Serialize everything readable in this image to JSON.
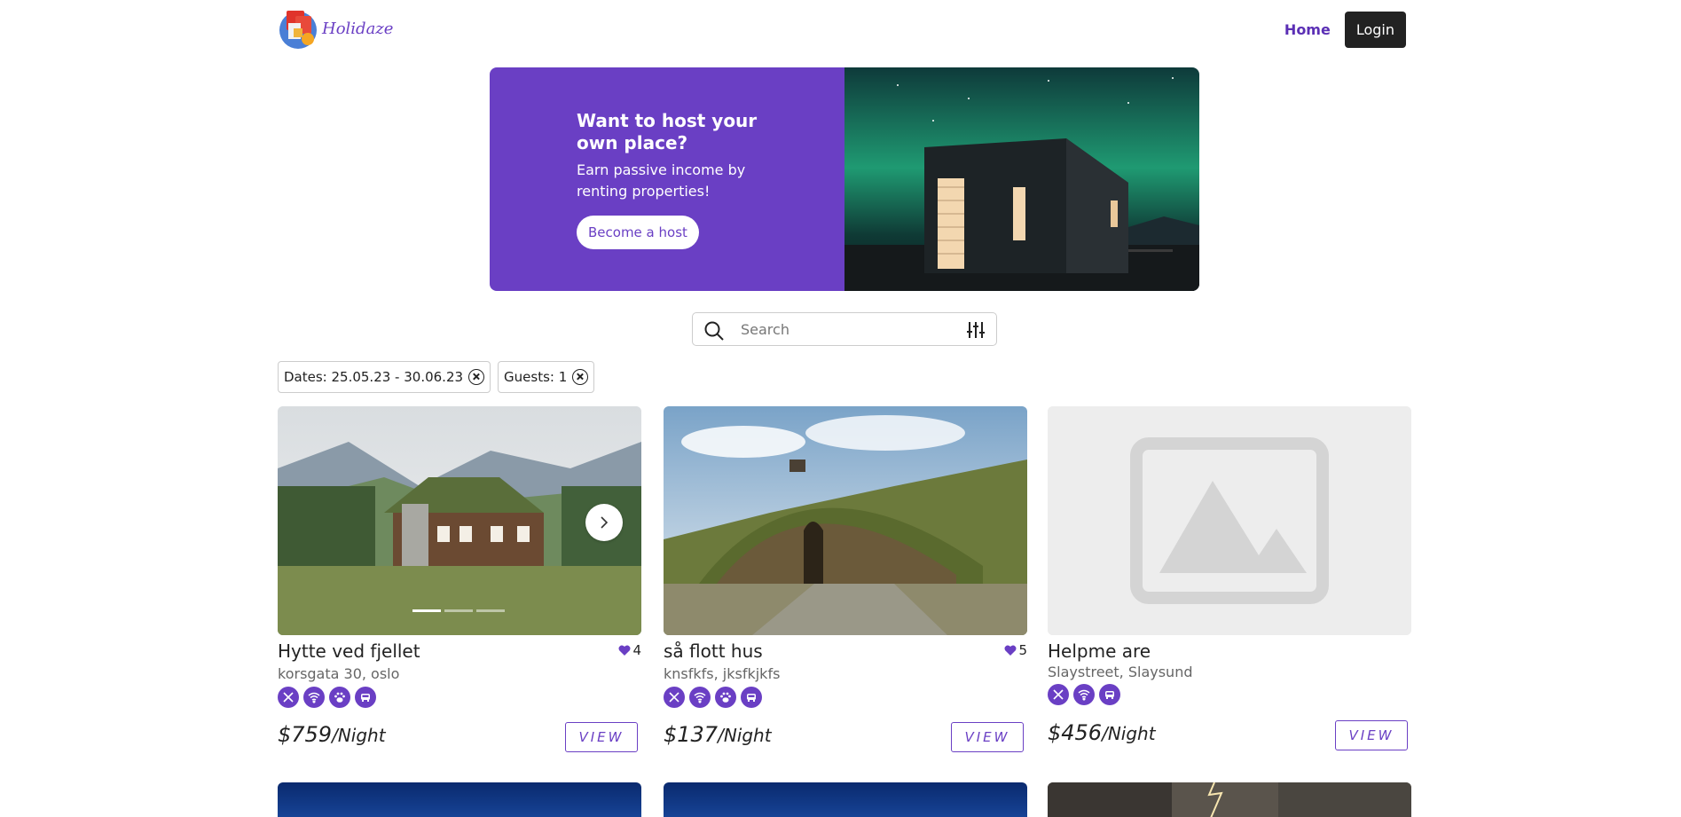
{
  "brand": {
    "name": "Holidaze",
    "accent": "#6a3fc4"
  },
  "nav": {
    "home": "Home",
    "login": "Login"
  },
  "hero": {
    "title": "Want to host your own place?",
    "subtitle": "Earn passive income by renting properties!",
    "cta": "Become a host"
  },
  "search": {
    "placeholder": "Search",
    "value": ""
  },
  "filters": [
    {
      "label": "Dates: 25.05.23 - 30.06.23"
    },
    {
      "label": "Guests: 1"
    }
  ],
  "listings": [
    {
      "title": "Hytte ved fjellet",
      "likes": "4",
      "address": "korsgata 30, oslo",
      "amenities": [
        "breakfast-icon",
        "wifi-icon",
        "pets-icon",
        "parking-icon"
      ],
      "price": "$759",
      "unit": "/Night",
      "view": "VIEW",
      "carousel": {
        "slides": 3,
        "active": 1
      }
    },
    {
      "title": "så flott hus",
      "likes": "5",
      "address": "knsfkfs, jksfkjkfs",
      "amenities": [
        "breakfast-icon",
        "wifi-icon",
        "pets-icon",
        "parking-icon"
      ],
      "price": "$137",
      "unit": "/Night",
      "view": "VIEW"
    },
    {
      "title": "Helpme are",
      "address": "Slaystreet, Slaysund",
      "amenities": [
        "breakfast-icon",
        "wifi-icon",
        "parking-icon"
      ],
      "price": "$456",
      "unit": "/Night",
      "view": "VIEW"
    }
  ]
}
